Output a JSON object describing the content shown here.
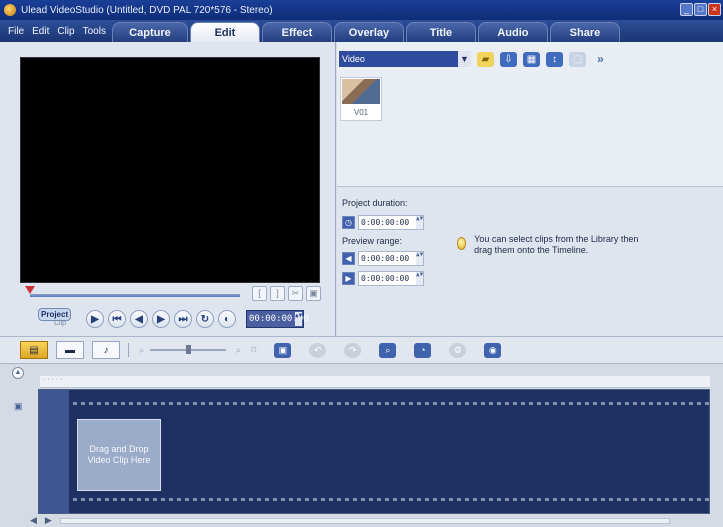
{
  "window": {
    "title": "Ulead VideoStudio (Untitled, DVD PAL 720*576 - Stereo)",
    "buttons": [
      "minimize",
      "maximize",
      "close"
    ]
  },
  "menu": [
    "File",
    "Edit",
    "Clip",
    "Tools"
  ],
  "tabs": [
    {
      "label": "Capture",
      "active": false
    },
    {
      "label": "Edit",
      "active": true
    },
    {
      "label": "Effect",
      "active": false
    },
    {
      "label": "Overlay",
      "active": false
    },
    {
      "label": "Title",
      "active": false
    },
    {
      "label": "Audio",
      "active": false
    },
    {
      "label": "Share",
      "active": false
    }
  ],
  "preview": {
    "mode_project": "Project",
    "mode_clip": "Clip",
    "timecode": "00:00:00:00",
    "transport_icons": [
      "play-icon",
      "home-icon",
      "previous-frame-icon",
      "next-frame-icon",
      "end-icon",
      "repeat-icon",
      "volume-icon"
    ]
  },
  "library": {
    "category": "Video",
    "items": [
      {
        "label": "V01"
      }
    ],
    "icon_names": [
      "folder-icon",
      "import-icon",
      "library-manager-icon",
      "sort-icon",
      "delete-icon",
      "expand-icon"
    ]
  },
  "options": {
    "project_duration_label": "Project duration:",
    "project_duration_value": "0:00:00:00",
    "preview_range_label": "Preview range:",
    "preview_range_start": "0:00:00:00",
    "preview_range_end": "0:00:00:00",
    "hint_text": "You can select clips from the Library then drag them onto the Timeline."
  },
  "timeline": {
    "drop_zone_text": "Drag and Drop Video Clip Here"
  }
}
